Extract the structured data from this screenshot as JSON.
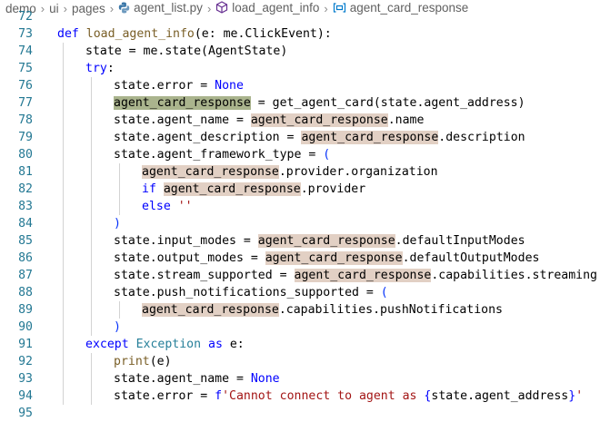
{
  "breadcrumb": {
    "items": [
      {
        "label": "demo"
      },
      {
        "label": "ui"
      },
      {
        "label": "pages"
      },
      {
        "label": "agent_list.py",
        "icon": "python-file-icon"
      },
      {
        "label": "load_agent_info",
        "icon": "method-icon"
      },
      {
        "label": "agent_card_response",
        "icon": "variable-icon"
      }
    ]
  },
  "editor": {
    "lines": [
      {
        "n": "72",
        "indent": 0,
        "tokens": []
      },
      {
        "n": "73",
        "indent": 0,
        "tokens": [
          {
            "t": "def ",
            "c": "kw"
          },
          {
            "t": "load_agent_info",
            "c": "fn"
          },
          {
            "t": "(e: me.ClickEvent):"
          }
        ]
      },
      {
        "n": "74",
        "indent": 1,
        "tokens": [
          {
            "t": "state = me.state(AgentState)"
          }
        ]
      },
      {
        "n": "75",
        "indent": 1,
        "tokens": [
          {
            "t": "try",
            "c": "kw"
          },
          {
            "t": ":"
          }
        ]
      },
      {
        "n": "76",
        "indent": 2,
        "tokens": [
          {
            "t": "state.error = "
          },
          {
            "t": "None",
            "c": "kw"
          }
        ]
      },
      {
        "n": "77",
        "indent": 2,
        "tokens": [
          {
            "t": "agent_card_response",
            "c": "hl-sel"
          },
          {
            "t": " = get_agent_card(state.agent_address)"
          }
        ]
      },
      {
        "n": "78",
        "indent": 2,
        "tokens": [
          {
            "t": "state.agent_name = "
          },
          {
            "t": "agent_card_response",
            "c": "hl"
          },
          {
            "t": ".name"
          }
        ]
      },
      {
        "n": "79",
        "indent": 2,
        "tokens": [
          {
            "t": "state.agent_description = "
          },
          {
            "t": "agent_card_response",
            "c": "hl"
          },
          {
            "t": ".description"
          }
        ]
      },
      {
        "n": "80",
        "indent": 2,
        "tokens": [
          {
            "t": "state.agent_framework_type = "
          },
          {
            "t": "(",
            "c": "paren-y"
          }
        ]
      },
      {
        "n": "81",
        "indent": 3,
        "tokens": [
          {
            "t": "agent_card_response",
            "c": "hl"
          },
          {
            "t": ".provider.organization"
          }
        ]
      },
      {
        "n": "82",
        "indent": 3,
        "tokens": [
          {
            "t": "if",
            "c": "kw"
          },
          {
            "t": " "
          },
          {
            "t": "agent_card_response",
            "c": "hl"
          },
          {
            "t": ".provider"
          }
        ]
      },
      {
        "n": "83",
        "indent": 3,
        "tokens": [
          {
            "t": "else",
            "c": "kw"
          },
          {
            "t": " "
          },
          {
            "t": "''",
            "c": "str"
          }
        ]
      },
      {
        "n": "84",
        "indent": 2,
        "tokens": [
          {
            "t": ")",
            "c": "paren-y"
          }
        ]
      },
      {
        "n": "85",
        "indent": 2,
        "tokens": [
          {
            "t": "state.input_modes = "
          },
          {
            "t": "agent_card_response",
            "c": "hl"
          },
          {
            "t": ".defaultInputModes"
          }
        ]
      },
      {
        "n": "86",
        "indent": 2,
        "tokens": [
          {
            "t": "state.output_modes = "
          },
          {
            "t": "agent_card_response",
            "c": "hl"
          },
          {
            "t": ".defaultOutputModes"
          }
        ]
      },
      {
        "n": "87",
        "indent": 2,
        "tokens": [
          {
            "t": "state.stream_supported = "
          },
          {
            "t": "agent_card_response",
            "c": "hl"
          },
          {
            "t": ".capabilities.streaming"
          }
        ]
      },
      {
        "n": "88",
        "indent": 2,
        "tokens": [
          {
            "t": "state.push_notifications_supported = "
          },
          {
            "t": "(",
            "c": "paren-y"
          }
        ]
      },
      {
        "n": "89",
        "indent": 3,
        "tokens": [
          {
            "t": "agent_card_response",
            "c": "hl"
          },
          {
            "t": ".capabilities.pushNotifications"
          }
        ]
      },
      {
        "n": "90",
        "indent": 2,
        "tokens": [
          {
            "t": ")",
            "c": "paren-y"
          }
        ]
      },
      {
        "n": "91",
        "indent": 1,
        "tokens": [
          {
            "t": "except",
            "c": "kw"
          },
          {
            "t": " "
          },
          {
            "t": "Exception",
            "c": "cls"
          },
          {
            "t": " "
          },
          {
            "t": "as",
            "c": "kw"
          },
          {
            "t": " e:"
          }
        ]
      },
      {
        "n": "92",
        "indent": 2,
        "tokens": [
          {
            "t": "print",
            "c": "fn"
          },
          {
            "t": "(e)"
          }
        ]
      },
      {
        "n": "93",
        "indent": 2,
        "tokens": [
          {
            "t": "state.agent_name = "
          },
          {
            "t": "None",
            "c": "kw"
          }
        ]
      },
      {
        "n": "94",
        "indent": 2,
        "tokens": [
          {
            "t": "state.error = "
          },
          {
            "t": "f",
            "c": "kw"
          },
          {
            "t": "'Cannot connect to agent as ",
            "c": "str"
          },
          {
            "t": "{",
            "c": "kw"
          },
          {
            "t": "state.agent_address"
          },
          {
            "t": "}",
            "c": "kw"
          },
          {
            "t": "'",
            "c": "str"
          }
        ]
      },
      {
        "n": "95",
        "indent": 0,
        "tokens": []
      }
    ]
  }
}
